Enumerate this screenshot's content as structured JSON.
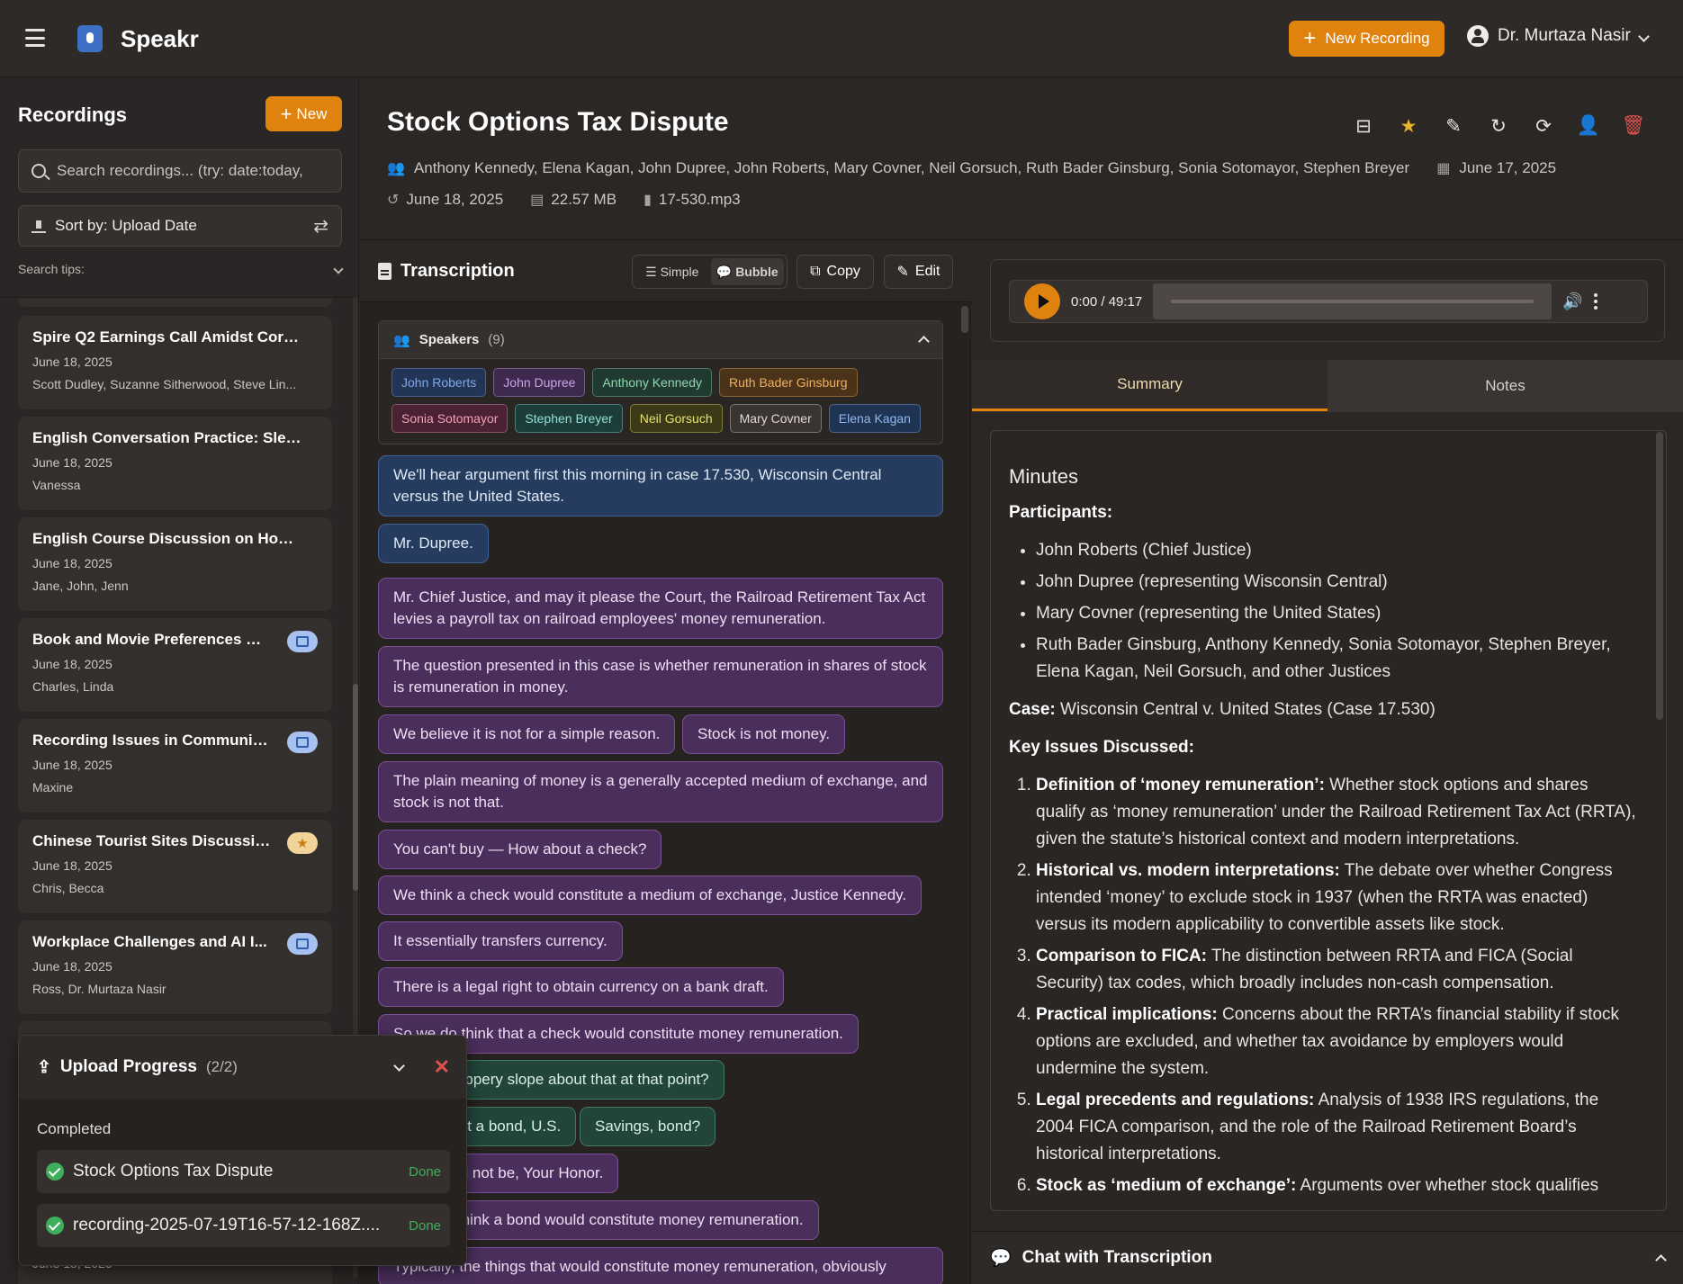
{
  "app": {
    "name": "Speakr"
  },
  "header": {
    "new_recording": "New Recording",
    "user": "Dr. Murtaza Nasir"
  },
  "sidebar": {
    "title": "Recordings",
    "new_label": "New",
    "search_placeholder": "Search recordings... (try: date:today,",
    "sort_label": "Sort by: Upload Date",
    "tips_label": "Search tips:",
    "items": [
      {
        "title": "Spire Q2 Earnings Call Amidst Coron...",
        "date": "June 18, 2025",
        "people": "Scott Dudley, Suzanne Sitherwood, Steve Lin...",
        "badge": ""
      },
      {
        "title": "English Conversation Practice: Sleep-...",
        "date": "June 18, 2025",
        "people": "Vanessa",
        "badge": ""
      },
      {
        "title": "English Course Discussion on Hobbie...",
        "date": "June 18, 2025",
        "people": "Jane, John, Jenn",
        "badge": ""
      },
      {
        "title": "Book and Movie Preferences Di...",
        "date": "June 18, 2025",
        "people": "Charles, Linda",
        "badge": "inbox"
      },
      {
        "title": "Recording Issues in Communic...",
        "date": "June 18, 2025",
        "people": "Maxine",
        "badge": "inbox"
      },
      {
        "title": "Chinese Tourist Sites Discussion",
        "date": "June 18, 2025",
        "people": "Chris, Becca",
        "badge": "star"
      },
      {
        "title": "Workplace Challenges and AI I...",
        "date": "June 18, 2025",
        "people": "Ross, Dr. Murtaza Nasir",
        "badge": "inbox"
      }
    ],
    "bottom_date": "June 18, 2025"
  },
  "upload": {
    "title": "Upload Progress",
    "count": "(2/2)",
    "section": "Completed",
    "items": [
      {
        "name": "Stock Options Tax Dispute",
        "status": "Done"
      },
      {
        "name": "recording-2025-07-19T16-57-12-168Z....",
        "status": "Done"
      }
    ]
  },
  "recording": {
    "title": "Stock Options Tax Dispute",
    "participants": "Anthony Kennedy, Elena Kagan, John Dupree, John Roberts, Mary Covner, Neil Gorsuch, Ruth Bader Ginsburg, Sonia Sotomayor, Stephen Breyer",
    "meeting_date": "June 17, 2025",
    "upload_date": "June 18, 2025",
    "size": "22.57 MB",
    "file": "17-530.mp3"
  },
  "transcription": {
    "title": "Transcription",
    "simple": "Simple",
    "bubble": "Bubble",
    "copy": "Copy",
    "edit": "Edit",
    "speakers_label": "Speakers",
    "speakers_count": "(9)",
    "speakers": [
      {
        "name": "John Roberts",
        "color": "#7fa7e8",
        "bg": "#233556"
      },
      {
        "name": "John Dupree",
        "color": "#c9a3e6",
        "bg": "#3e2a4e"
      },
      {
        "name": "Anthony Kennedy",
        "color": "#8fd6b0",
        "bg": "#203a31"
      },
      {
        "name": "Ruth Bader Ginsburg",
        "color": "#f0b060",
        "bg": "#4a3318"
      },
      {
        "name": "Sonia Sotomayor",
        "color": "#f0a0b8",
        "bg": "#4a2233"
      },
      {
        "name": "Stephen Breyer",
        "color": "#8fe0d6",
        "bg": "#1d3d3a"
      },
      {
        "name": "Neil Gorsuch",
        "color": "#e8e070",
        "bg": "#3c3a16"
      },
      {
        "name": "Mary Covner",
        "color": "#e0d8d2",
        "bg": "#3a3533"
      },
      {
        "name": "Elena Kagan",
        "color": "#90b8f0",
        "bg": "#1f3352"
      }
    ],
    "bubbles": [
      {
        "text": "We'll hear argument first this morning in case 17.530, Wisconsin Central versus the United States.",
        "style": "blue"
      },
      {
        "text": "Mr. Dupree.",
        "style": "blue"
      },
      {
        "text": "Mr. Chief Justice, and may it please the Court, the Railroad Retirement Tax Act levies a payroll tax on railroad employees' money remuneration.",
        "style": "purp"
      },
      {
        "text": "The question presented in this case is whether remuneration in shares of stock is remuneration in money.",
        "style": "purp"
      },
      {
        "text": "We believe it is not for a simple reason.",
        "style": "purp"
      },
      {
        "text": "Stock is not money.",
        "style": "purp"
      },
      {
        "text": "The plain meaning of money is a generally accepted medium of exchange, and stock is not that.",
        "style": "purp"
      },
      {
        "text": "You can't buy — How about a check?",
        "style": "purp"
      },
      {
        "text": "We think a check would constitute a medium of exchange, Justice Kennedy.",
        "style": "purp"
      },
      {
        "text": "It essentially transfers currency.",
        "style": "purp"
      },
      {
        "text": "There is a legal right to obtain currency on a bank draft.",
        "style": "purp"
      },
      {
        "text": "So we do think that a check would constitute money remuneration.",
        "style": "purp"
      },
      {
        "text": "And the slippery slope about that at that point?",
        "style": "green"
      },
      {
        "text": "What about a bond, U.S.",
        "style": "green"
      },
      {
        "text": "Savings, bond?",
        "style": "green"
      },
      {
        "text": "That would not be, Your Honor.",
        "style": "purp"
      },
      {
        "text": "We don't think a bond would constitute money remuneration.",
        "style": "purp"
      },
      {
        "text": "Typically, the things that would constitute money remuneration, obviously",
        "style": "purp"
      }
    ]
  },
  "player": {
    "time": "0:00 / 49:17"
  },
  "tabs": {
    "summary": "Summary",
    "notes": "Notes"
  },
  "summary": {
    "heading": "Minutes",
    "participants_label": "Participants:",
    "participants": [
      "John Roberts (Chief Justice)",
      "John Dupree (representing Wisconsin Central)",
      "Mary Covner (representing the United States)",
      "Ruth Bader Ginsburg, Anthony Kennedy, Sonia Sotomayor, Stephen Breyer, Elena Kagan, Neil Gorsuch, and other Justices"
    ],
    "case_label": "Case:",
    "case_text": " Wisconsin Central v. United States (Case 17.530)",
    "issues_label": "Key Issues Discussed:",
    "issues": [
      {
        "head": "Definition of ‘money remuneration’:",
        "text": " Whether stock options and shares qualify as ‘money remuneration’ under the Railroad Retirement Tax Act (RRTA), given the statute’s historical context and modern interpretations."
      },
      {
        "head": "Historical vs. modern interpretations:",
        "text": " The debate over whether Congress intended ‘money’ to exclude stock in 1937 (when the RRTA was enacted) versus its modern applicability to convertible assets like stock."
      },
      {
        "head": "Comparison to FICA:",
        "text": " The distinction between RRTA and FICA (Social Security) tax codes, which broadly includes non-cash compensation."
      },
      {
        "head": "Practical implications:",
        "text": " Concerns about the RRTA’s financial stability if stock options are excluded, and whether tax avoidance by employers would undermine the system."
      },
      {
        "head": "Legal precedents and regulations:",
        "text": " Analysis of 1938 IRS regulations, the 2004 FICA comparison, and the role of the Railroad Retirement Board’s historical interpretations."
      },
      {
        "head": "Stock as ‘medium of exchange’:",
        "text": " Arguments over whether stock qualifies"
      }
    ]
  },
  "chat": {
    "label": "Chat with Transcription"
  }
}
